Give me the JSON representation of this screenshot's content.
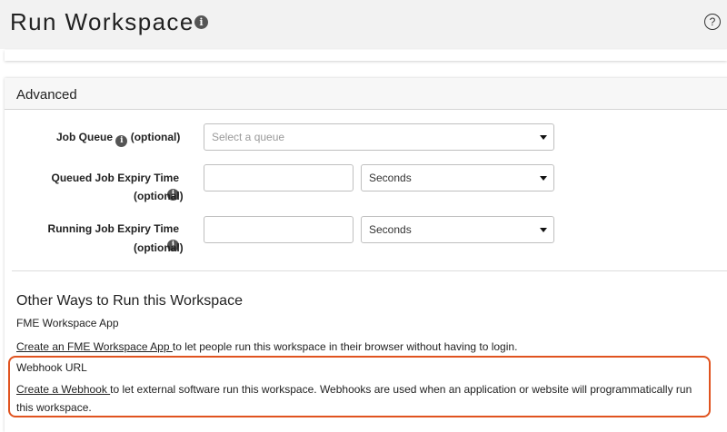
{
  "header": {
    "title": "Run Workspace",
    "help_glyph": "?"
  },
  "advanced": {
    "title": "Advanced",
    "job_queue": {
      "label": "Job Queue",
      "optional": "(optional)",
      "placeholder": "Select a queue"
    },
    "queued_expiry": {
      "label": "Queued Job Expiry Time",
      "optional": "(optional)",
      "value": "",
      "unit": "Seconds"
    },
    "running_expiry": {
      "label": "Running Job Expiry Time",
      "optional": "(optional)",
      "value": "",
      "unit": "Seconds"
    }
  },
  "other_ways": {
    "title": "Other Ways to Run this Workspace",
    "app_title": "FME Workspace App",
    "app_link": "Create an FME Workspace App ",
    "app_text": "to let people run this workspace in their browser without having to login.",
    "webhook_title": "Webhook URL",
    "webhook_link": "Create a Webhook ",
    "webhook_text": "to let external software run this workspace. Webhooks are used when an application or website will programmatically run this workspace."
  },
  "colors": {
    "highlight": "#e0531f",
    "header_bg": "#f2f2f2"
  },
  "icons": [
    "info-icon",
    "help-icon",
    "dropdown-caret-icon"
  ]
}
